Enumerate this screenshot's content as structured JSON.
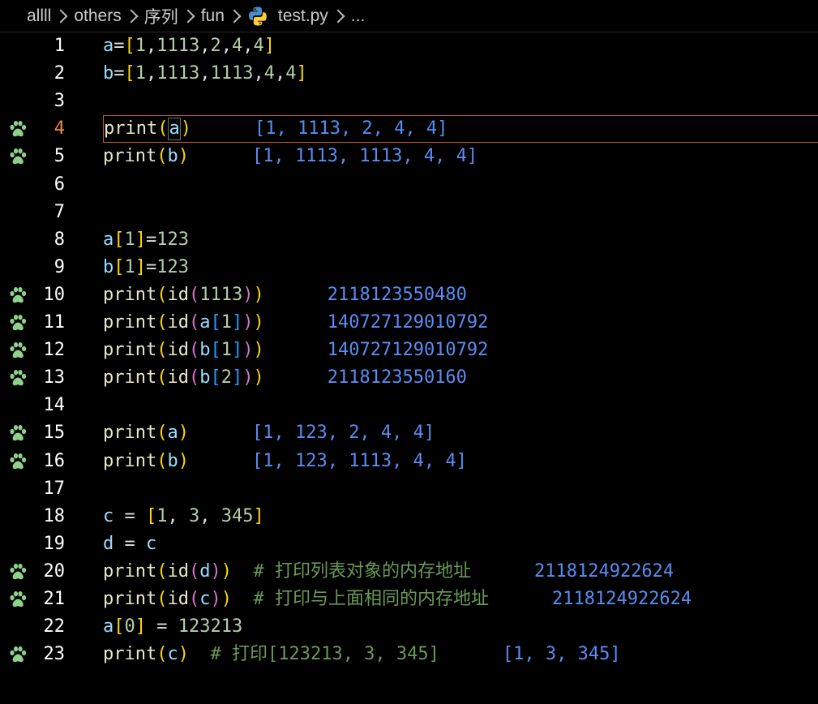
{
  "breadcrumb": {
    "items": [
      "allll",
      "others",
      "序列",
      "fun"
    ],
    "file": "test.py",
    "trailing": "..."
  },
  "icons": {
    "gutter": "paw-print-icon",
    "file": "python-file-icon",
    "separator": "chevron-right-icon"
  },
  "colors": {
    "background": "#000000",
    "line_number": "#ffffff",
    "active_line_number": "#f0883e",
    "current_line_border": "#c1582f",
    "inline_output": "#5b8cf2",
    "comment": "#6a9955",
    "gutter_icon": "#8fd18b"
  },
  "lines": [
    {
      "n": "1",
      "code": "a=[1,1113,2,4,4]",
      "output": "",
      "icon": false
    },
    {
      "n": "2",
      "code": "b=[1,1113,1113,4,4]",
      "output": "",
      "icon": false
    },
    {
      "n": "3",
      "code": "",
      "output": "",
      "icon": false
    },
    {
      "n": "4",
      "code": "print(a)",
      "output": "[1, 1113, 2, 4, 4]",
      "icon": true,
      "active": true
    },
    {
      "n": "5",
      "code": "print(b)",
      "output": "[1, 1113, 1113, 4, 4]",
      "icon": true
    },
    {
      "n": "6",
      "code": "",
      "output": "",
      "icon": false
    },
    {
      "n": "7",
      "code": "",
      "output": "",
      "icon": false
    },
    {
      "n": "8",
      "code": "a[1]=123",
      "output": "",
      "icon": false
    },
    {
      "n": "9",
      "code": "b[1]=123",
      "output": "",
      "icon": false
    },
    {
      "n": "10",
      "code": "print(id(1113))",
      "output": "2118123550480",
      "icon": true
    },
    {
      "n": "11",
      "code": "print(id(a[1]))",
      "output": "140727129010792",
      "icon": true
    },
    {
      "n": "12",
      "code": "print(id(b[1]))",
      "output": "140727129010792",
      "icon": true
    },
    {
      "n": "13",
      "code": "print(id(b[2]))",
      "output": "2118123550160",
      "icon": true
    },
    {
      "n": "14",
      "code": "",
      "output": "",
      "icon": false
    },
    {
      "n": "15",
      "code": "print(a)",
      "output": "[1, 123, 2, 4, 4]",
      "icon": true
    },
    {
      "n": "16",
      "code": "print(b)",
      "output": "[1, 123, 1113, 4, 4]",
      "icon": true
    },
    {
      "n": "17",
      "code": "",
      "output": "",
      "icon": false
    },
    {
      "n": "18",
      "code": "c = [1, 3, 345]",
      "output": "",
      "icon": false
    },
    {
      "n": "19",
      "code": "d = c",
      "output": "",
      "icon": false
    },
    {
      "n": "20",
      "code": "print(id(d))",
      "comment": "# 打印列表对象的内存地址",
      "output": "2118124922624",
      "icon": true
    },
    {
      "n": "21",
      "code": "print(id(c))",
      "comment": "# 打印与上面相同的内存地址",
      "output": "2118124922624",
      "icon": true
    },
    {
      "n": "22",
      "code": "a[0] = 123213",
      "output": "",
      "icon": false
    },
    {
      "n": "23",
      "code": "print(c)",
      "comment": "# 打印[123213, 3, 345]",
      "output": "[1, 3, 345]",
      "icon": true
    }
  ]
}
